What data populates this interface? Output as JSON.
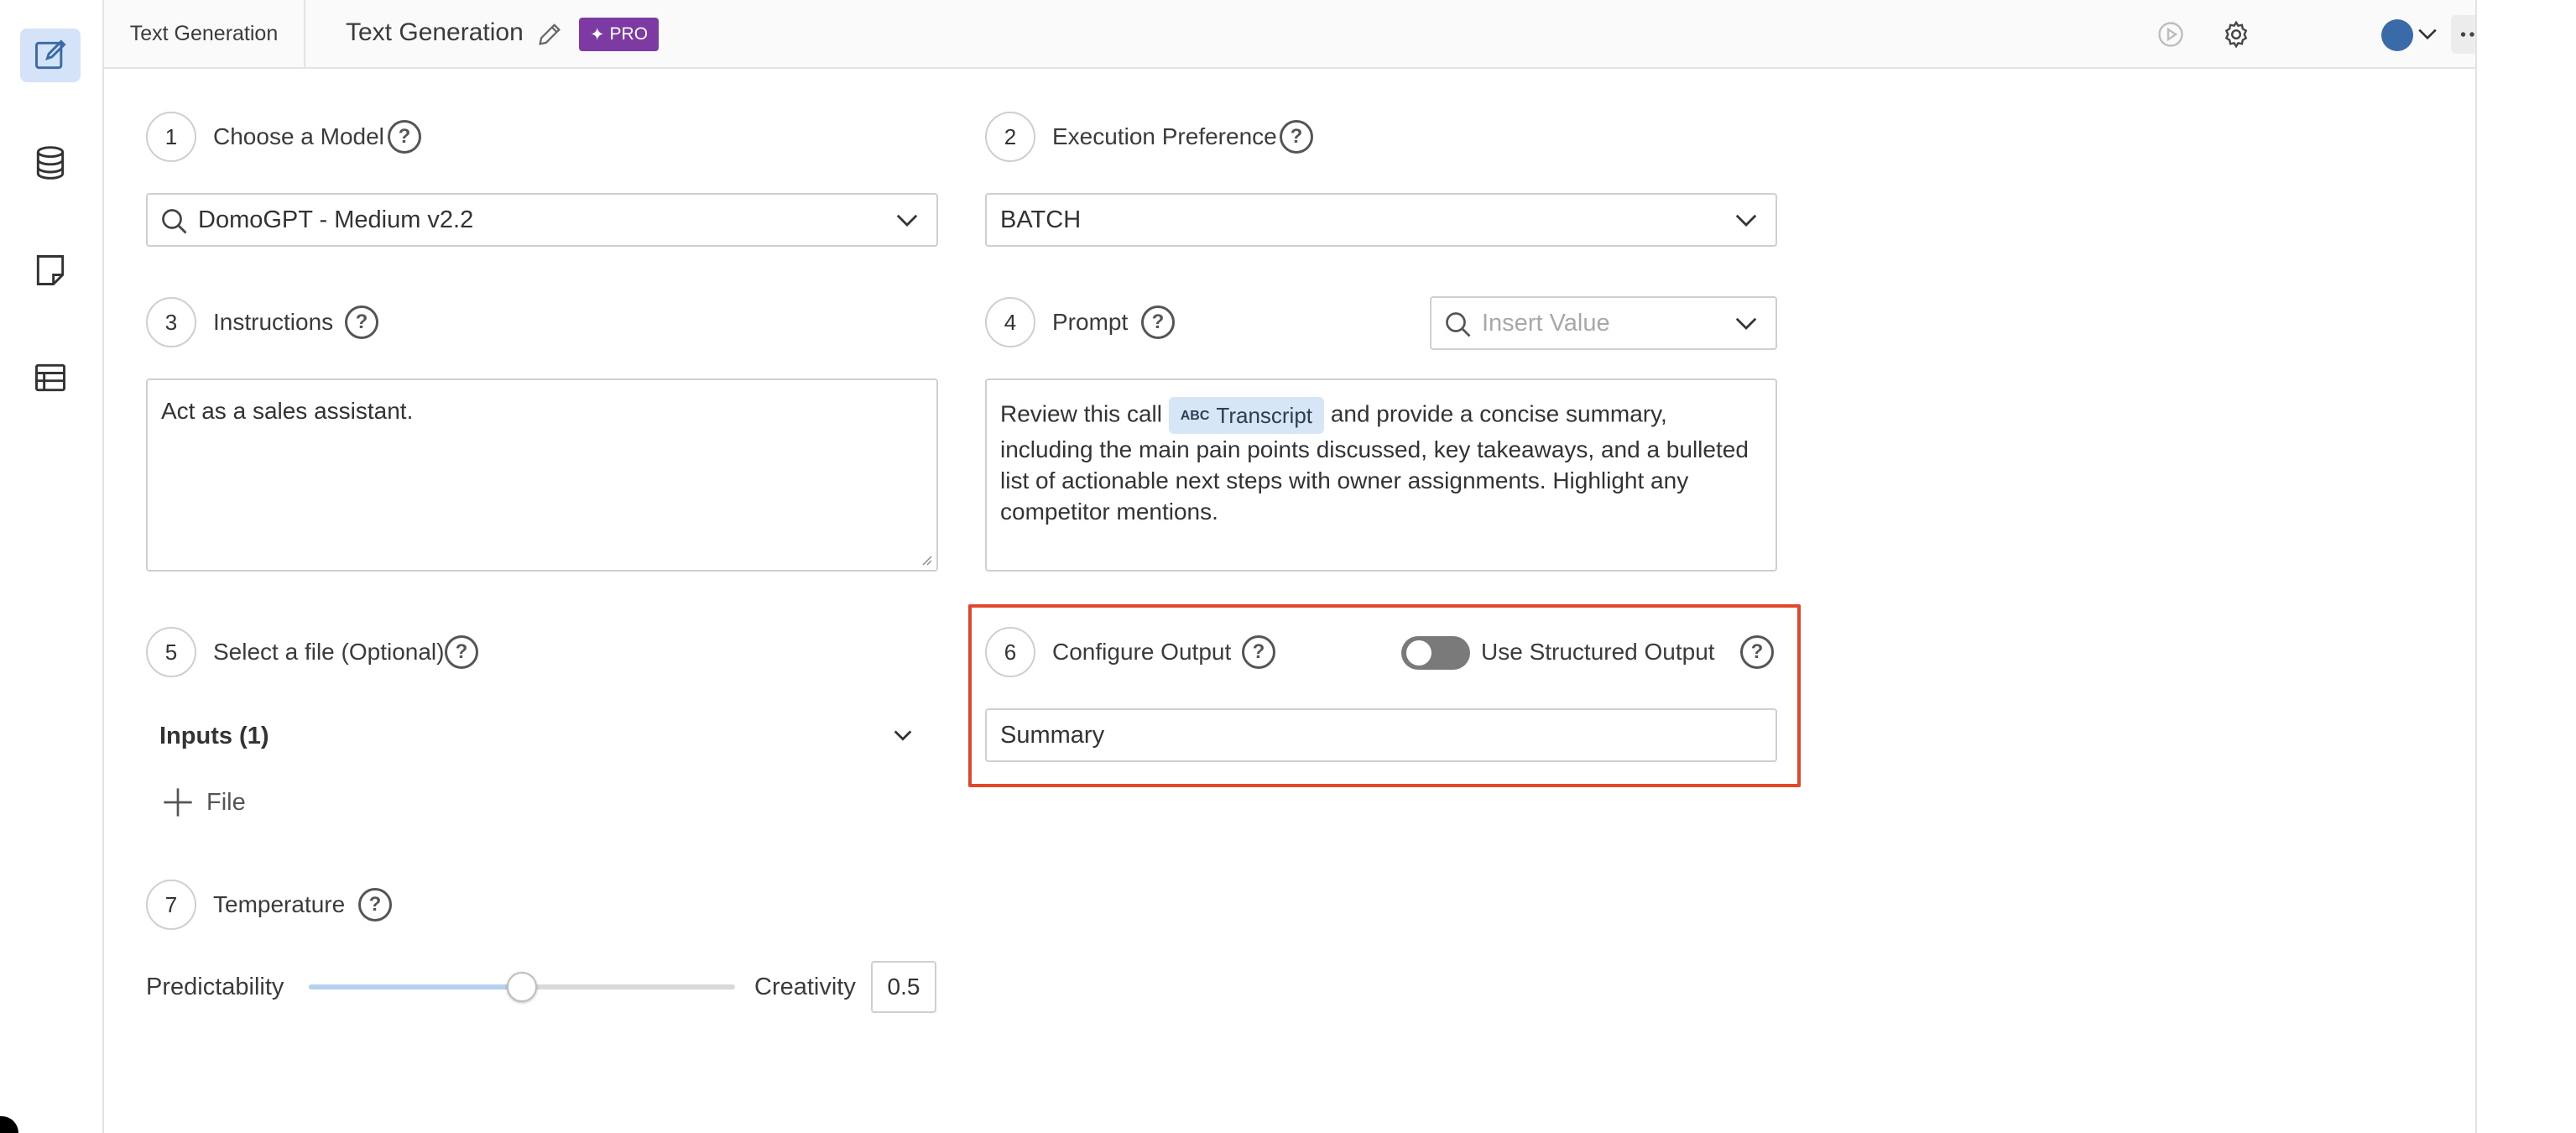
{
  "header": {
    "tab_label": "Text Generation",
    "title": "Text Generation",
    "pro_badge": "PRO",
    "icons": [
      "play-icon",
      "gear-icon",
      "avatar",
      "chevron-down-icon",
      "more-icon",
      "pin-icon"
    ]
  },
  "sidebar": {
    "items": [
      {
        "icon": "edit-icon",
        "active": true
      },
      {
        "icon": "database-icon",
        "active": false
      },
      {
        "icon": "note-icon",
        "active": false
      },
      {
        "icon": "table-icon",
        "active": false
      }
    ]
  },
  "steps": {
    "model": {
      "num": "1",
      "label": "Choose a Model",
      "value": "DomoGPT - Medium v2.2"
    },
    "execution": {
      "num": "2",
      "label": "Execution Preference",
      "value": "BATCH"
    },
    "instructions": {
      "num": "3",
      "label": "Instructions",
      "value": "Act as a sales assistant."
    },
    "prompt": {
      "num": "4",
      "label": "Prompt",
      "insert_placeholder": "Insert Value",
      "text_before": "Review this call",
      "chip_type": "ABC",
      "chip_label": "Transcript",
      "text_after": "and provide a concise summary, including the main pain points discussed, key takeaways, and a bulleted list of actionable next steps with owner assignments. Highlight any competitor mentions."
    },
    "file": {
      "num": "5",
      "label": "Select a file (Optional)",
      "inputs_label": "Inputs (1)",
      "add_file_label": "File"
    },
    "output": {
      "num": "6",
      "label": "Configure Output",
      "structured_label": "Use Structured Output",
      "structured_enabled": false,
      "value": "Summary"
    },
    "temperature": {
      "num": "7",
      "label": "Temperature",
      "left_label": "Predictability",
      "right_label": "Creativity",
      "value": "0.5",
      "level": 0.5
    }
  },
  "help_symbol": "?",
  "colors": {
    "accent": "#e0472b",
    "pro": "#7c3aa2",
    "chip": "#d6e6f7",
    "active_nav": "#d4e3f7"
  }
}
